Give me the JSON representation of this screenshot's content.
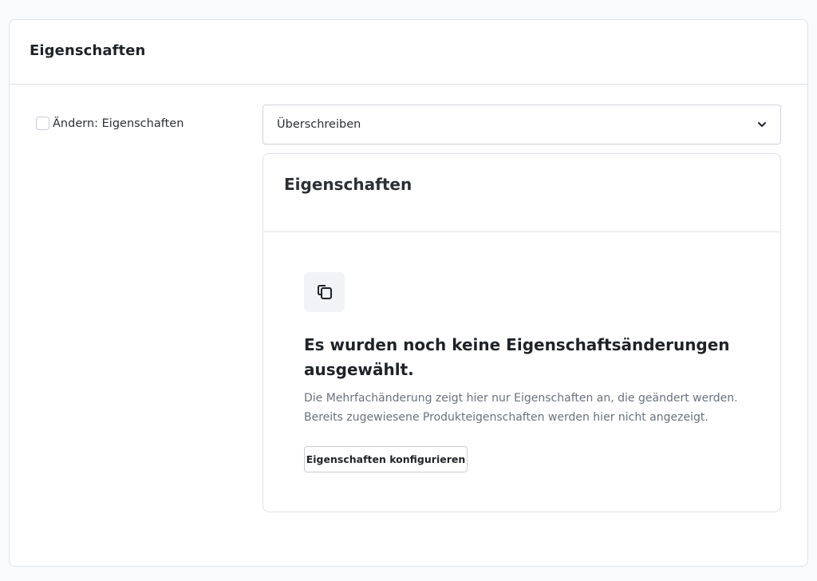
{
  "card": {
    "title": "Eigenschaften"
  },
  "change_toggle": {
    "checked": false,
    "label": "Ändern: Eigenschaften"
  },
  "mode_select": {
    "value": "Überschreiben",
    "icon": "chevron-down-icon"
  },
  "properties_panel": {
    "title": "Eigenschaften",
    "empty_state": {
      "icon": "copy-icon",
      "title": "Es wurden noch keine Eigenschaftsänderungen ausgewählt.",
      "description": "Die Mehrfachänderung zeigt hier nur Eigenschaften an, die geändert werden. Bereits zugewiesene Produkteigenschaften werden hier nicht angezeigt.",
      "button_label": "Eigenschaften konfigurieren"
    }
  }
}
